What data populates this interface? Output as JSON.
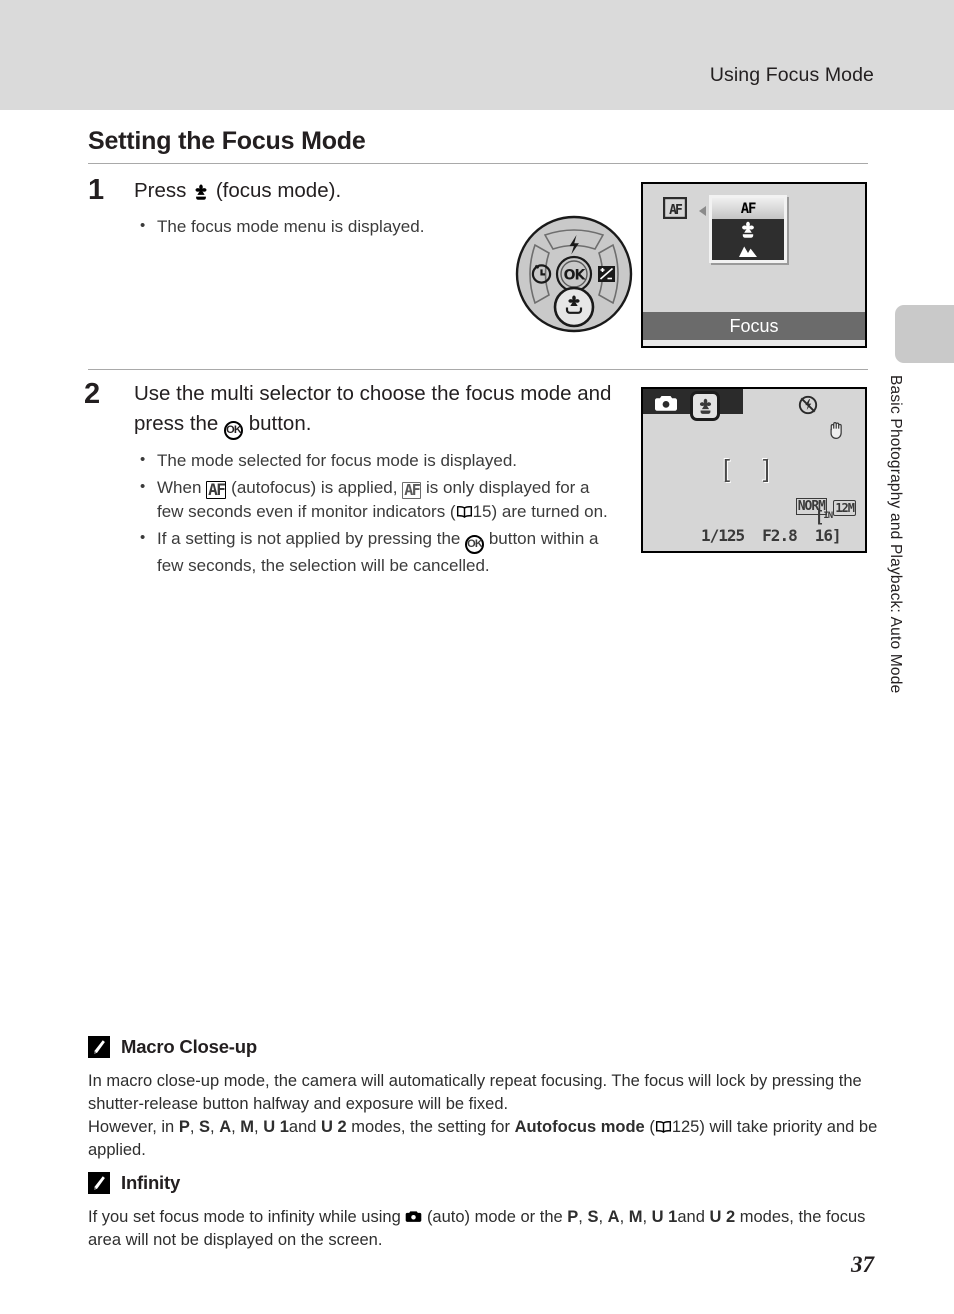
{
  "header": {
    "title": "Using Focus Mode"
  },
  "side_tab": {
    "label": "Basic Photography and Playback: Auto Mode"
  },
  "section": {
    "title": "Setting the Focus Mode"
  },
  "steps": [
    {
      "number": "1",
      "head_pre": "Press",
      "head_icon": "macro-flower-icon",
      "head_post": "(focus mode).",
      "bullets": [
        {
          "text": "The focus mode menu is displayed."
        }
      ]
    },
    {
      "number": "2",
      "head_pre": "Use the multi selector to choose the focus mode and press the",
      "head_icon": "ok-button-icon",
      "head_post": "button.",
      "bullets": [
        {
          "text": "The mode selected for focus mode is displayed."
        },
        {
          "p1": "When",
          "icon1": "AF",
          "p2": "(autofocus) is applied,",
          "icon2": "AF",
          "p3": "is only displayed for a few seconds even if monitor indicators (",
          "ref": "15",
          "p4": ") are turned on."
        },
        {
          "p1": "If a setting is not applied by pressing the",
          "icon1": "ok-button-icon",
          "p2": "button within a few seconds, the selection will be cancelled."
        }
      ]
    }
  ],
  "dial": {
    "flash_label": "flash-icon",
    "self_timer_label": "self-timer-icon",
    "exposure_label": "exposure-compensation-icon",
    "macro_label": "macro-flower-icon",
    "center_label": "OK"
  },
  "lcd_focus_menu": {
    "left_indicator": "AF",
    "options": [
      {
        "label": "AF",
        "type": "text",
        "selected": true
      },
      {
        "label": "macro-flower-icon",
        "type": "icon",
        "selected": false
      },
      {
        "label": "infinity-mountain-icon",
        "type": "icon",
        "selected": false
      }
    ],
    "caption": "Focus"
  },
  "lcd_shooting": {
    "mode_icon": "camera-auto-icon",
    "focus_icon": "macro-flower-icon",
    "flash_icon": "flash-off-icon",
    "vr_icon": "vibration-reduction-icon",
    "focus_brackets": "[  ]",
    "image_quality": "NORM",
    "image_size": "12M",
    "shutter_speed": "1/125",
    "aperture": "F2.8",
    "memory_label": "IN",
    "shots_remaining": "16"
  },
  "notes": [
    {
      "badge": "pencil-icon",
      "title": "Macro Close-up",
      "line1": "In macro close-up mode, the camera will automatically repeat focusing. The focus will lock by pressing the shutter-release button halfway and exposure will be fixed.",
      "line2_pre": "However, in",
      "modes": [
        "P",
        "S",
        "A",
        "M",
        "U 1"
      ],
      "modes_last": "U 2",
      "line2_mid": "modes, the setting for",
      "bold_ref": "Autofocus mode",
      "page_ref": "125",
      "line2_post": ") will take priority and be applied."
    },
    {
      "badge": "pencil-icon",
      "title": "Infinity",
      "line1_pre": "If you set focus mode to infinity while using",
      "auto_icon": "camera-auto-icon",
      "line1_mid": "(auto) mode or the",
      "modes": [
        "P",
        "S",
        "A",
        "M",
        "U 1"
      ],
      "modes_last": "U 2",
      "line1_post": "modes, the focus area will not be displayed on the screen."
    }
  ],
  "page_number": "37"
}
